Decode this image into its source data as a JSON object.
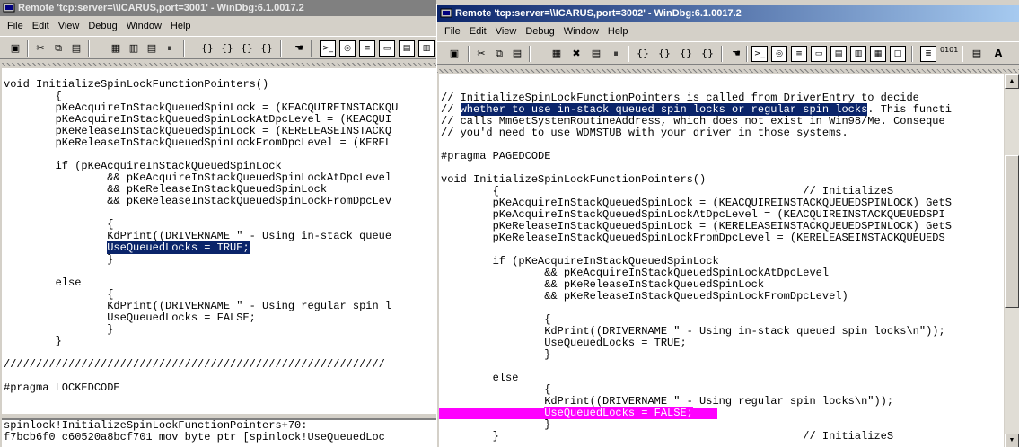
{
  "windows": {
    "left": {
      "title": "Remote 'tcp:server=\\\\ICARUS,port=3001' - WinDbg:6.1.0017.2",
      "menu": [
        "File",
        "Edit",
        "View",
        "Debug",
        "Window",
        "Help"
      ],
      "source_lines": [
        "void InitializeSpinLockFunctionPointers()",
        "        {",
        "        pKeAcquireInStackQueuedSpinLock = (KEACQUIREINSTACKQU",
        "        pKeAcquireInStackQueuedSpinLockAtDpcLevel = (KEACQUI",
        "        pKeReleaseInStackQueuedSpinLock = (KERELEASEINSTACKQ",
        "        pKeReleaseInStackQueuedSpinLockFromDpcLevel = (KEREL",
        "",
        "        if (pKeAcquireInStackQueuedSpinLock",
        "                && pKeAcquireInStackQueuedSpinLockAtDpcLevel",
        "                && pKeReleaseInStackQueuedSpinLock",
        "                && pKeReleaseInStackQueuedSpinLockFromDpcLev",
        "",
        "                {",
        "                KdPrint((DRIVERNAME \" - Using in-stack queue",
        "                UseQueuedLocks = TRUE;",
        "                }",
        "",
        "        else",
        "                {",
        "                KdPrint((DRIVERNAME \" - Using regular spin l",
        "                UseQueuedLocks = FALSE;",
        "                }",
        "        }",
        "",
        "///////////////////////////////////////////////////////////",
        "",
        "#pragma LOCKEDCODE"
      ],
      "highlighted_line": 14,
      "command_lines": [
        "spinlock!InitializeSpinLockFunctionPointers+70:",
        "f7bcb6f0 c60520a8bcf701 mov byte ptr [spinlock!UseQueuedLoc"
      ]
    },
    "right": {
      "title": "Remote 'tcp:server=\\\\ICARUS,port=3002' - WinDbg:6.1.0017.2",
      "menu": [
        "File",
        "Edit",
        "View",
        "Debug",
        "Window",
        "Help"
      ],
      "source_lines": [
        "// InitializeSpinLockFunctionPointers is called from DriverEntry to decide",
        "// whether to use in-stack queued spin locks or regular spin locks. This functi",
        "// calls MmGetSystemRoutineAddress, which does not exist in Win98/Me. Conseque",
        "// you'd need to use WDMSTUB with your driver in those systems.",
        "",
        "#pragma PAGEDCODE",
        "",
        "void InitializeSpinLockFunctionPointers()",
        "        {                                               // InitializeS",
        "        pKeAcquireInStackQueuedSpinLock = (KEACQUIREINSTACKQUEUEDSPINLOCK) GetS",
        "        pKeAcquireInStackQueuedSpinLockAtDpcLevel = (KEACQUIREINSTACKQUEUEDSPI",
        "        pKeReleaseInStackQueuedSpinLock = (KERELEASEINSTACKQUEUEDSPINLOCK) GetS",
        "        pKeReleaseInStackQueuedSpinLockFromDpcLevel = (KERELEASEINSTACKQUEUEDS",
        "",
        "        if (pKeAcquireInStackQueuedSpinLock",
        "                && pKeAcquireInStackQueuedSpinLockAtDpcLevel",
        "                && pKeReleaseInStackQueuedSpinLock",
        "                && pKeReleaseInStackQueuedSpinLockFromDpcLevel)",
        "",
        "                {",
        "                KdPrint((DRIVERNAME \" - Using in-stack queued spin locks\\n\"));",
        "                UseQueuedLocks = TRUE;",
        "                }",
        "",
        "        else",
        "                {",
        "                KdPrint((DRIVERNAME \" - Using regular spin locks\\n\"));",
        "                UseQueuedLocks = FALSE;",
        "                }",
        "        }                                               // InitializeS"
      ],
      "selection": {
        "line": 1,
        "prefix": "// ",
        "selected_text": "whether to use in-stack queued spin locks or regular spin locks",
        "suffix": ". This functi"
      },
      "current_line": 27,
      "current_line_color": "#ff00ff"
    }
  },
  "colors": {
    "active_title": "#0a246a",
    "inactive_title": "#808080",
    "selection": "#0a246a",
    "current_statement": "#ff00ff"
  },
  "toolbar_icons": [
    "open-icon",
    "cut-icon",
    "copy-icon",
    "paste-icon",
    "restart-icon",
    "stop-icon",
    "go-icon",
    "step-into-icon",
    "step-over-icon",
    "step-out-icon",
    "run-to-cursor-icon",
    "breakpoint-hand-icon",
    "command-window-icon",
    "watch-icon",
    "locals-icon",
    "registers-icon",
    "memory-icon",
    "callstack-icon",
    "disassembly-icon",
    "scratch-icon",
    "source-mode-icon",
    "hex-icon",
    "options-icon",
    "font-icon"
  ],
  "toolbar_glyphs": {
    "step_into": "{}",
    "source_mode": "0101",
    "font": "A"
  }
}
